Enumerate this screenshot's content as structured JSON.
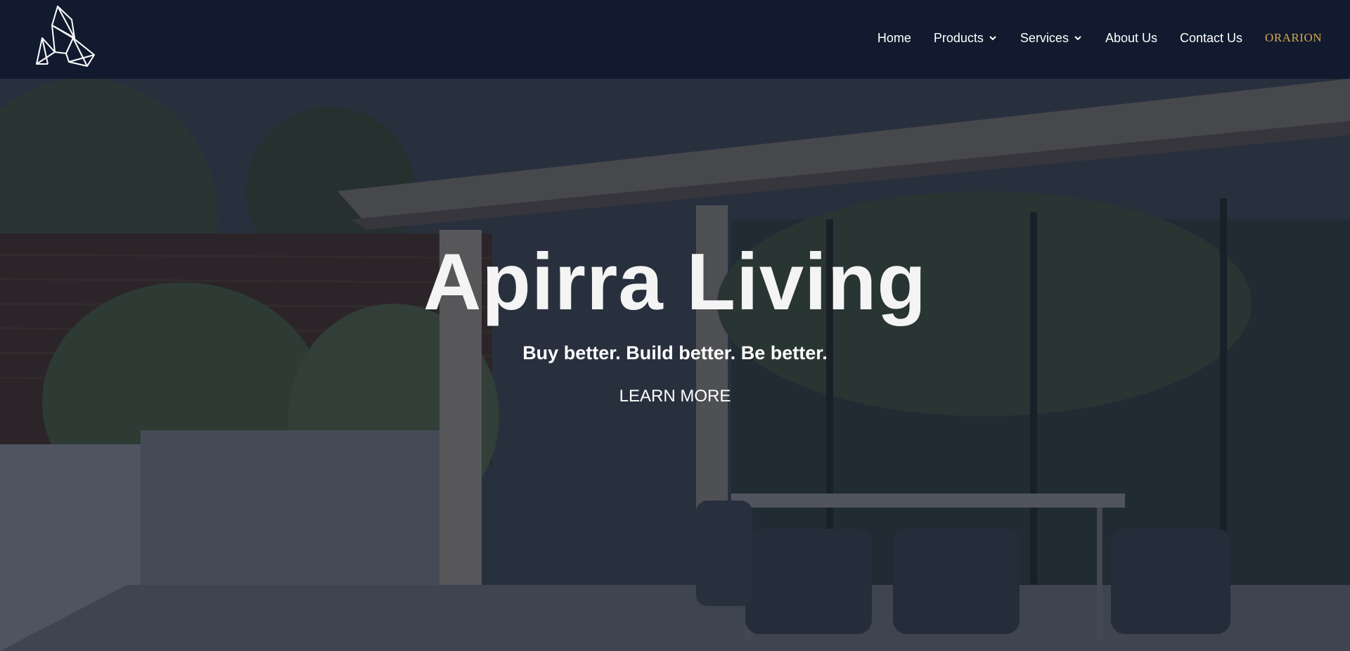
{
  "header": {
    "logo_icon": "faceted-crystal-logo-icon",
    "nav": {
      "home": "Home",
      "products": "Products",
      "services": "Services",
      "about": "About Us",
      "contact": "Contact Us",
      "brand": "ORARION"
    },
    "caret_icon": "chevron-down-icon"
  },
  "hero": {
    "title": "Apirra Living",
    "subtitle": "Buy better. Build better. Be better.",
    "cta": "LEARN MORE",
    "background": "patio-with-glass-doors-and-outdoor-dining-set"
  },
  "colors": {
    "navbar_bg": "#111a2e",
    "brand_text": "#d7a94b",
    "text": "#ffffff"
  }
}
